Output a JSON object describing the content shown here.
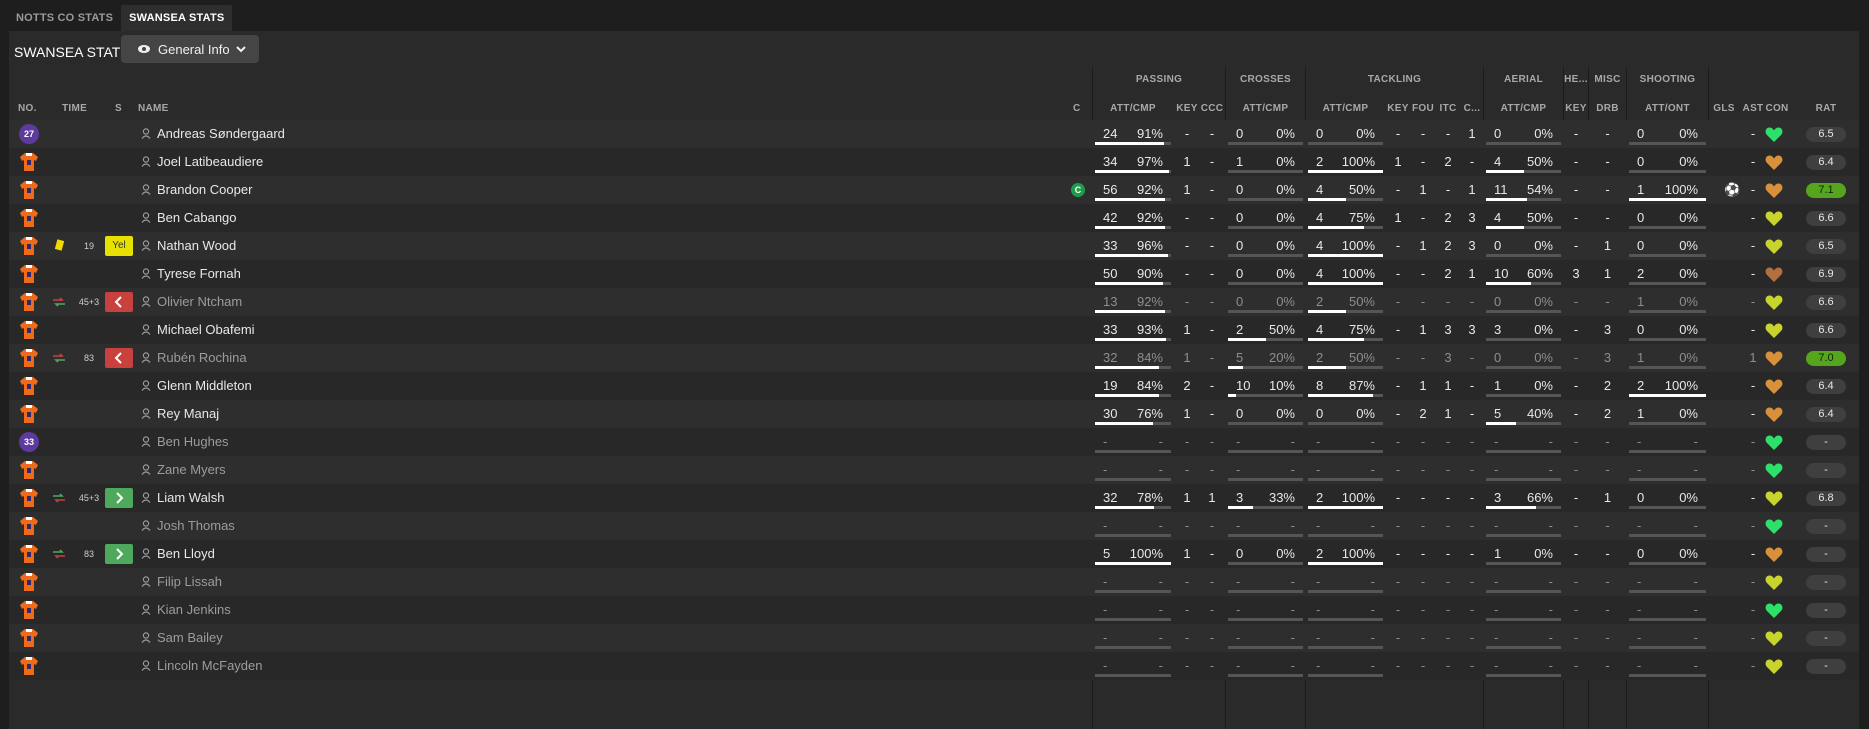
{
  "tabs": [
    "NOTTS CO STATS",
    "SWANSEA STATS"
  ],
  "panel_title": "SWANSEA STATS",
  "view_selector": {
    "label": "General Info",
    "icon": "eye-icon"
  },
  "group_headers": {
    "passing": "PASSING",
    "crosses": "CROSSES",
    "tackling": "TACKLING",
    "aerial": "AERIAL",
    "headers": "HE...",
    "misc": "MISC",
    "shooting": "SHOOTING"
  },
  "columns": {
    "no": "NO.",
    "time": "TIME",
    "s": "S",
    "name": "NAME",
    "c": "C",
    "pass_attcmp": "ATT/CMP",
    "pass_key": "KEY",
    "pass_ccc": "CCC",
    "cross_attcmp": "ATT/CMP",
    "tack_attcmp": "ATT/CMP",
    "tack_key": "KEY",
    "tack_fou": "FOU",
    "tack_itc": "ITC",
    "tack_c": "C...",
    "aer_attcmp": "ATT/CMP",
    "he_key": "KEY",
    "misc_drb": "DRB",
    "shoot_attont": "ATT/ONT",
    "gls": "GLS",
    "ast": "AST",
    "con": "CON",
    "rat": "RAT"
  },
  "colors": {
    "shirt_orange": "#f06a1c",
    "rating_green": "#55a61c",
    "heart_green": "#2ee06a",
    "heart_yellow": "#c8d42e",
    "heart_orange": "#d8903a",
    "subbed_off": "#c9413c",
    "subbed_on": "#4fa95c",
    "yellow_card": "#e8e000"
  },
  "players": [
    {
      "no": "27",
      "badge": true,
      "name": "Andreas Søndergaard",
      "pass": [
        "24",
        "91%"
      ],
      "pk": "-",
      "pc": "-",
      "cross": [
        "0",
        "0%"
      ],
      "tack": [
        "0",
        "0%"
      ],
      "tk": "-",
      "tf": "-",
      "ti": "-",
      "tc": "1",
      "aer": [
        "0",
        "0%"
      ],
      "hk": "-",
      "drb": "-",
      "shot": [
        "0",
        "0%"
      ],
      "gls": "",
      "ast": "-",
      "con": "green",
      "rat": "6.5",
      "bars": [
        0.91,
        0,
        0,
        0,
        0
      ]
    },
    {
      "no": "",
      "name": "Joel Latibeaudiere",
      "pass": [
        "34",
        "97%"
      ],
      "pk": "1",
      "pc": "-",
      "cross": [
        "1",
        "0%"
      ],
      "tack": [
        "2",
        "100%"
      ],
      "tk": "1",
      "tf": "-",
      "ti": "2",
      "tc": "-",
      "aer": [
        "4",
        "50%"
      ],
      "hk": "-",
      "drb": "-",
      "shot": [
        "0",
        "0%"
      ],
      "gls": "",
      "ast": "-",
      "con": "orange",
      "rat": "6.4",
      "bars": [
        0.97,
        0,
        1,
        0.5,
        0
      ]
    },
    {
      "no": "",
      "name": "Brandon Cooper",
      "captain": "C",
      "pass": [
        "56",
        "92%"
      ],
      "pk": "1",
      "pc": "-",
      "cross": [
        "0",
        "0%"
      ],
      "tack": [
        "4",
        "50%"
      ],
      "tk": "-",
      "tf": "1",
      "ti": "-",
      "tc": "1",
      "aer": [
        "11",
        "54%"
      ],
      "hk": "-",
      "drb": "-",
      "shot": [
        "1",
        "100%"
      ],
      "goal": true,
      "gls": "",
      "ast": "-",
      "con": "orange",
      "rat": "7.1",
      "ratgreen": true,
      "bars": [
        0.92,
        0,
        0.5,
        0.54,
        1
      ]
    },
    {
      "no": "",
      "name": "Ben Cabango",
      "pass": [
        "42",
        "92%"
      ],
      "pk": "-",
      "pc": "-",
      "cross": [
        "0",
        "0%"
      ],
      "tack": [
        "4",
        "75%"
      ],
      "tk": "1",
      "tf": "-",
      "ti": "2",
      "tc": "3",
      "aer": [
        "4",
        "50%"
      ],
      "hk": "-",
      "drb": "-",
      "shot": [
        "0",
        "0%"
      ],
      "gls": "",
      "ast": "-",
      "con": "yellow",
      "rat": "6.6",
      "bars": [
        0.92,
        0,
        0.75,
        0.5,
        0
      ]
    },
    {
      "no": "",
      "name": "Nathan Wood",
      "ycard": true,
      "time": "19",
      "status": "Yel",
      "pass": [
        "33",
        "96%"
      ],
      "pk": "-",
      "pc": "-",
      "cross": [
        "0",
        "0%"
      ],
      "tack": [
        "4",
        "100%"
      ],
      "tk": "-",
      "tf": "1",
      "ti": "2",
      "tc": "3",
      "aer": [
        "0",
        "0%"
      ],
      "hk": "-",
      "drb": "1",
      "shot": [
        "0",
        "0%"
      ],
      "gls": "",
      "ast": "-",
      "con": "yellow",
      "rat": "6.5",
      "bars": [
        0.96,
        0,
        1,
        0,
        0
      ]
    },
    {
      "no": "",
      "name": "Tyrese Fornah",
      "pass": [
        "50",
        "90%"
      ],
      "pk": "-",
      "pc": "-",
      "cross": [
        "0",
        "0%"
      ],
      "tack": [
        "4",
        "100%"
      ],
      "tk": "-",
      "tf": "-",
      "ti": "2",
      "tc": "1",
      "aer": [
        "10",
        "60%"
      ],
      "hk": "3",
      "drb": "1",
      "shot": [
        "2",
        "0%"
      ],
      "gls": "",
      "ast": "-",
      "con": "brown",
      "rat": "6.9",
      "bars": [
        0.9,
        0,
        1,
        0.6,
        0
      ]
    },
    {
      "no": "",
      "name": "Olivier Ntcham",
      "sub": true,
      "subicon": true,
      "time": "45+3",
      "status": "off",
      "pass": [
        "13",
        "92%"
      ],
      "pk": "-",
      "pc": "-",
      "cross": [
        "0",
        "0%"
      ],
      "tack": [
        "2",
        "50%"
      ],
      "tk": "-",
      "tf": "-",
      "ti": "-",
      "tc": "-",
      "aer": [
        "0",
        "0%"
      ],
      "hk": "-",
      "drb": "-",
      "shot": [
        "1",
        "0%"
      ],
      "gls": "",
      "ast": "-",
      "con": "yellow",
      "rat": "6.6",
      "bars": [
        0.92,
        0,
        0.5,
        0,
        0
      ]
    },
    {
      "no": "",
      "name": "Michael Obafemi",
      "pass": [
        "33",
        "93%"
      ],
      "pk": "1",
      "pc": "-",
      "cross": [
        "2",
        "50%"
      ],
      "tack": [
        "4",
        "75%"
      ],
      "tk": "-",
      "tf": "1",
      "ti": "3",
      "tc": "3",
      "aer": [
        "3",
        "0%"
      ],
      "hk": "-",
      "drb": "3",
      "shot": [
        "0",
        "0%"
      ],
      "gls": "",
      "ast": "-",
      "con": "yellow",
      "rat": "6.6",
      "bars": [
        0.93,
        0.5,
        0.75,
        0,
        0
      ]
    },
    {
      "no": "",
      "name": "Rubén Rochina",
      "sub": true,
      "subicon": true,
      "time": "83",
      "status": "off",
      "pass": [
        "32",
        "84%"
      ],
      "pk": "1",
      "pc": "-",
      "cross": [
        "5",
        "20%"
      ],
      "tack": [
        "2",
        "50%"
      ],
      "tk": "-",
      "tf": "-",
      "ti": "3",
      "tc": "-",
      "aer": [
        "0",
        "0%"
      ],
      "hk": "-",
      "drb": "3",
      "shot": [
        "1",
        "0%"
      ],
      "gls": "",
      "ast": "1",
      "con": "orange",
      "rat": "7.0",
      "ratgreen": true,
      "bars": [
        0.84,
        0.2,
        0.5,
        0,
        0
      ]
    },
    {
      "no": "",
      "name": "Glenn Middleton",
      "pass": [
        "19",
        "84%"
      ],
      "pk": "2",
      "pc": "-",
      "cross": [
        "10",
        "10%"
      ],
      "tack": [
        "8",
        "87%"
      ],
      "tk": "-",
      "tf": "1",
      "ti": "1",
      "tc": "-",
      "aer": [
        "1",
        "0%"
      ],
      "hk": "-",
      "drb": "2",
      "shot": [
        "2",
        "100%"
      ],
      "gls": "",
      "ast": "-",
      "con": "orange",
      "rat": "6.4",
      "bars": [
        0.84,
        0.1,
        0.87,
        0,
        1
      ]
    },
    {
      "no": "",
      "name": "Rey Manaj",
      "pass": [
        "30",
        "76%"
      ],
      "pk": "1",
      "pc": "-",
      "cross": [
        "0",
        "0%"
      ],
      "tack": [
        "0",
        "0%"
      ],
      "tk": "-",
      "tf": "2",
      "ti": "1",
      "tc": "-",
      "aer": [
        "5",
        "40%"
      ],
      "hk": "-",
      "drb": "2",
      "shot": [
        "1",
        "0%"
      ],
      "gls": "",
      "ast": "-",
      "con": "orange",
      "rat": "6.4",
      "bars": [
        0.76,
        0,
        0,
        0.4,
        0
      ]
    },
    {
      "no": "33",
      "badge": true,
      "name": "Ben Hughes",
      "sub": true,
      "pass": [
        "-",
        "-"
      ],
      "pk": "-",
      "pc": "-",
      "cross": [
        "-",
        "-"
      ],
      "tack": [
        "-",
        "-"
      ],
      "tk": "-",
      "tf": "-",
      "ti": "-",
      "tc": "-",
      "aer": [
        "-",
        "-"
      ],
      "hk": "-",
      "drb": "-",
      "shot": [
        "-",
        "-"
      ],
      "gls": "",
      "ast": "-",
      "con": "green",
      "rat": "-",
      "bars": [
        0,
        0,
        0,
        0,
        0
      ]
    },
    {
      "no": "",
      "name": "Zane Myers",
      "sub": true,
      "pass": [
        "-",
        "-"
      ],
      "pk": "-",
      "pc": "-",
      "cross": [
        "-",
        "-"
      ],
      "tack": [
        "-",
        "-"
      ],
      "tk": "-",
      "tf": "-",
      "ti": "-",
      "tc": "-",
      "aer": [
        "-",
        "-"
      ],
      "hk": "-",
      "drb": "-",
      "shot": [
        "-",
        "-"
      ],
      "gls": "",
      "ast": "-",
      "con": "green",
      "rat": "-",
      "bars": [
        0,
        0,
        0,
        0,
        0
      ]
    },
    {
      "no": "",
      "name": "Liam Walsh",
      "subicon": true,
      "subon": true,
      "time": "45+3",
      "status": "on",
      "pass": [
        "32",
        "78%"
      ],
      "pk": "1",
      "pc": "1",
      "cross": [
        "3",
        "33%"
      ],
      "tack": [
        "2",
        "100%"
      ],
      "tk": "-",
      "tf": "-",
      "ti": "-",
      "tc": "-",
      "aer": [
        "3",
        "66%"
      ],
      "hk": "-",
      "drb": "1",
      "shot": [
        "0",
        "0%"
      ],
      "gls": "",
      "ast": "-",
      "con": "yellow",
      "rat": "6.8",
      "bars": [
        0.78,
        0.33,
        1,
        0.66,
        0
      ]
    },
    {
      "no": "",
      "name": "Josh Thomas",
      "sub": true,
      "pass": [
        "-",
        "-"
      ],
      "pk": "-",
      "pc": "-",
      "cross": [
        "-",
        "-"
      ],
      "tack": [
        "-",
        "-"
      ],
      "tk": "-",
      "tf": "-",
      "ti": "-",
      "tc": "-",
      "aer": [
        "-",
        "-"
      ],
      "hk": "-",
      "drb": "-",
      "shot": [
        "-",
        "-"
      ],
      "gls": "",
      "ast": "-",
      "con": "green",
      "rat": "-",
      "bars": [
        0,
        0,
        0,
        0,
        0
      ]
    },
    {
      "no": "",
      "name": "Ben Lloyd",
      "subicon": true,
      "subon": true,
      "time": "83",
      "status": "on",
      "pass": [
        "5",
        "100%"
      ],
      "pk": "1",
      "pc": "-",
      "cross": [
        "0",
        "0%"
      ],
      "tack": [
        "2",
        "100%"
      ],
      "tk": "-",
      "tf": "-",
      "ti": "-",
      "tc": "-",
      "aer": [
        "1",
        "0%"
      ],
      "hk": "-",
      "drb": "-",
      "shot": [
        "0",
        "0%"
      ],
      "gls": "",
      "ast": "-",
      "con": "orange",
      "rat": "-",
      "bars": [
        1,
        0,
        1,
        0,
        0
      ]
    },
    {
      "no": "",
      "name": "Filip Lissah",
      "sub": true,
      "pass": [
        "-",
        "-"
      ],
      "pk": "-",
      "pc": "-",
      "cross": [
        "-",
        "-"
      ],
      "tack": [
        "-",
        "-"
      ],
      "tk": "-",
      "tf": "-",
      "ti": "-",
      "tc": "-",
      "aer": [
        "-",
        "-"
      ],
      "hk": "-",
      "drb": "-",
      "shot": [
        "-",
        "-"
      ],
      "gls": "",
      "ast": "-",
      "con": "yellow",
      "rat": "-",
      "bars": [
        0,
        0,
        0,
        0,
        0
      ]
    },
    {
      "no": "",
      "name": "Kian Jenkins",
      "sub": true,
      "pass": [
        "-",
        "-"
      ],
      "pk": "-",
      "pc": "-",
      "cross": [
        "-",
        "-"
      ],
      "tack": [
        "-",
        "-"
      ],
      "tk": "-",
      "tf": "-",
      "ti": "-",
      "tc": "-",
      "aer": [
        "-",
        "-"
      ],
      "hk": "-",
      "drb": "-",
      "shot": [
        "-",
        "-"
      ],
      "gls": "",
      "ast": "-",
      "con": "green",
      "rat": "-",
      "bars": [
        0,
        0,
        0,
        0,
        0
      ]
    },
    {
      "no": "",
      "name": "Sam Bailey",
      "sub": true,
      "pass": [
        "-",
        "-"
      ],
      "pk": "-",
      "pc": "-",
      "cross": [
        "-",
        "-"
      ],
      "tack": [
        "-",
        "-"
      ],
      "tk": "-",
      "tf": "-",
      "ti": "-",
      "tc": "-",
      "aer": [
        "-",
        "-"
      ],
      "hk": "-",
      "drb": "-",
      "shot": [
        "-",
        "-"
      ],
      "gls": "",
      "ast": "-",
      "con": "yellow",
      "rat": "-",
      "bars": [
        0,
        0,
        0,
        0,
        0
      ]
    },
    {
      "no": "",
      "name": "Lincoln McFayden",
      "sub": true,
      "pass": [
        "-",
        "-"
      ],
      "pk": "-",
      "pc": "-",
      "cross": [
        "-",
        "-"
      ],
      "tack": [
        "-",
        "-"
      ],
      "tk": "-",
      "tf": "-",
      "ti": "-",
      "tc": "-",
      "aer": [
        "-",
        "-"
      ],
      "hk": "-",
      "drb": "-",
      "shot": [
        "-",
        "-"
      ],
      "gls": "",
      "ast": "-",
      "con": "yellow",
      "rat": "-",
      "bars": [
        0,
        0,
        0,
        0,
        0
      ]
    }
  ]
}
